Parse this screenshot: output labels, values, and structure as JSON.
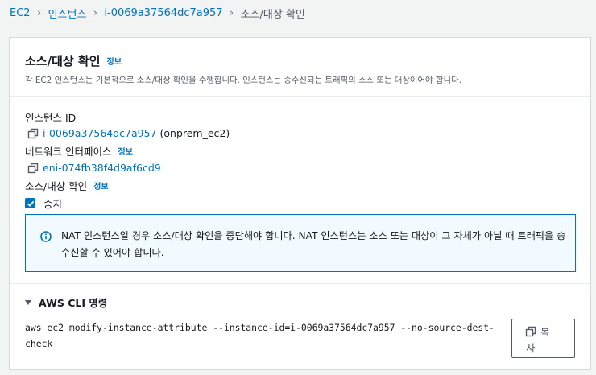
{
  "breadcrumb": {
    "items": [
      "EC2",
      "인스턴스",
      "i-0069a37564dc7a957"
    ],
    "current": "소스/대상 확인"
  },
  "header": {
    "title": "소스/대상 확인",
    "info": "정보",
    "description": "각 EC2 인스턴스는 기본적으로 소스/대상 확인을 수행합니다. 인스턴스는 송수신되는 트래픽의 소스 또는 대상이어야 합니다."
  },
  "instance": {
    "label": "인스턴스 ID",
    "id": "i-0069a37564dc7a957",
    "name": "(onprem_ec2)"
  },
  "network_interface": {
    "label": "네트워크 인터페이스",
    "info": "정보",
    "id": "eni-074fb38f4d9af6cd9"
  },
  "check": {
    "label": "소스/대상 확인",
    "info": "정보",
    "checkbox_label": "중지",
    "checked": true
  },
  "alert": {
    "text": "NAT 인스턴스일 경우 소스/대상 확인을 중단해야 합니다. NAT 인스턴스는 소스 또는 대상이 그 자체가 아닐 때 트래픽을 송수신할 수 있어야 합니다."
  },
  "cli": {
    "title": "AWS CLI 명령",
    "command": "aws ec2 modify-instance-attribute --instance-id=i-0069a37564dc7a957 --no-source-dest-check",
    "copy_line1": "복",
    "copy_line2": "사"
  },
  "colors": {
    "link": "#0073bb",
    "alert_border": "#0073bb",
    "alert_bg": "#f1faff"
  }
}
